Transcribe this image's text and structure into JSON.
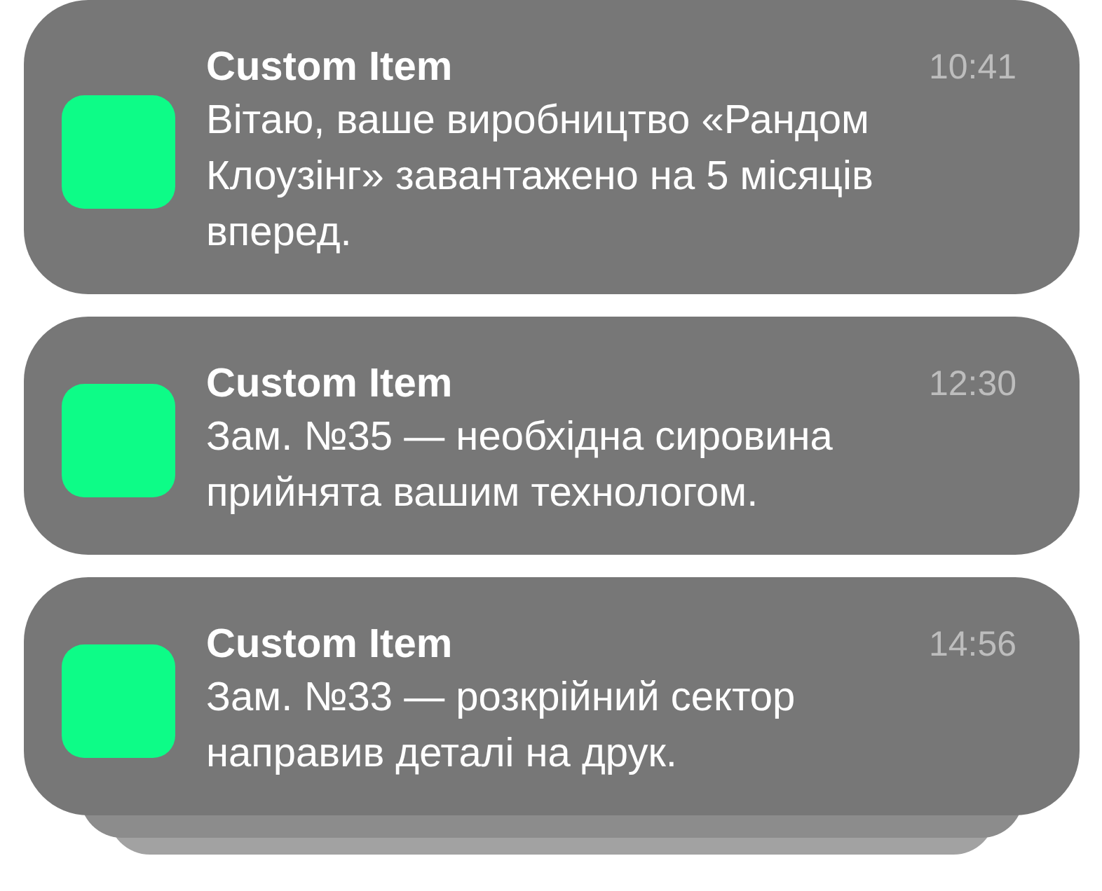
{
  "notifications": [
    {
      "title": "Custom Item",
      "time": "10:41",
      "message": "Вітаю, ваше виробництво «Рандом Клоузінг» завантажено на 5 місяців вперед."
    },
    {
      "title": "Custom Item",
      "time": "12:30",
      "message": "Зам. №35 — необхідна сировина прийнята вашим технологом."
    },
    {
      "title": "Custom Item",
      "time": "14:56",
      "message": "Зам. №33 — розкрійний сектор направив деталі на друк."
    }
  ]
}
